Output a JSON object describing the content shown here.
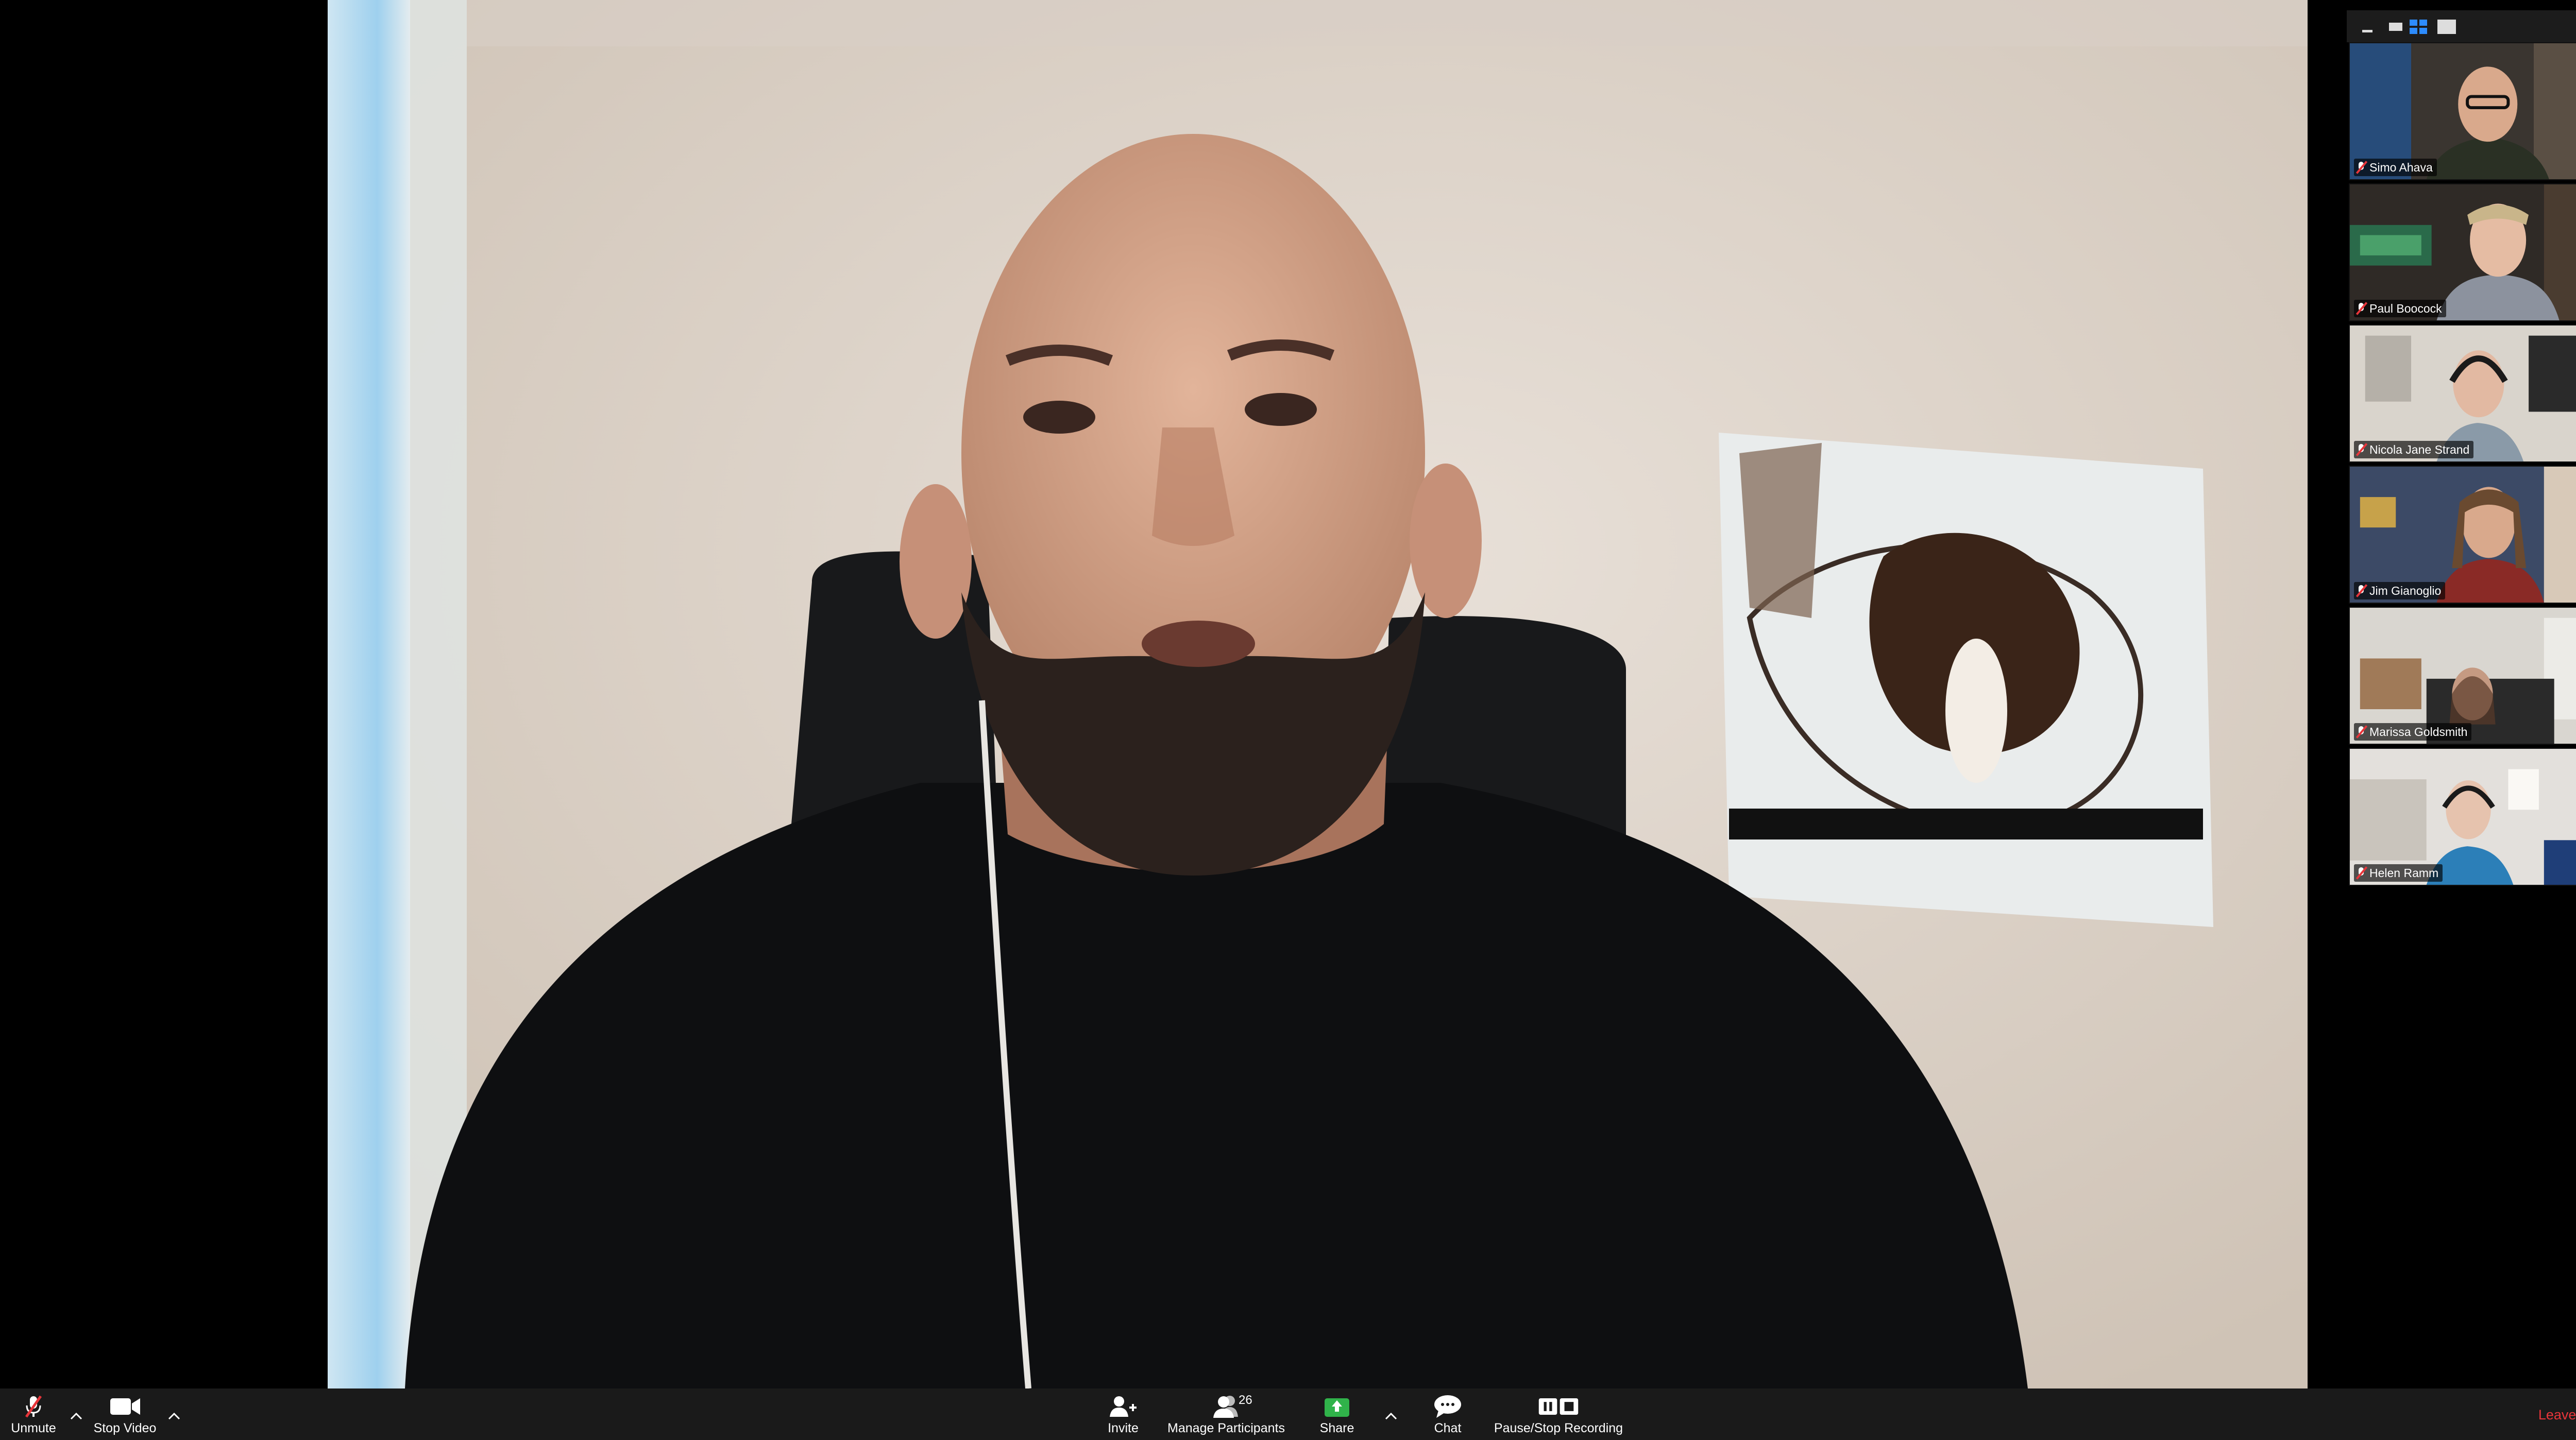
{
  "main_speaker": {
    "name": ""
  },
  "gallery": {
    "participants": [
      {
        "name": "Simo Ahava",
        "muted": true
      },
      {
        "name": "Paul Boocock",
        "muted": true
      },
      {
        "name": "Nicola Jane Strand",
        "muted": true
      },
      {
        "name": "Jim Gianoglio",
        "muted": true
      },
      {
        "name": "Marissa Goldsmith",
        "muted": true
      },
      {
        "name": "Helen Ramm",
        "muted": true
      }
    ]
  },
  "toolbar": {
    "unmute_label": "Unmute",
    "stop_video_label": "Stop Video",
    "invite_label": "Invite",
    "manage_participants_label": "Manage Participants",
    "participant_count": "26",
    "share_label": "Share",
    "chat_label": "Chat",
    "recording_label": "Pause/Stop Recording",
    "leave_label": "Leave Meeting"
  },
  "colors": {
    "toolbar_bg": "#1a1a1a",
    "share_green": "#30b34a",
    "leave_red": "#e8353a",
    "muted_red": "#e8353a",
    "active_view_blue": "#2d8cff"
  }
}
